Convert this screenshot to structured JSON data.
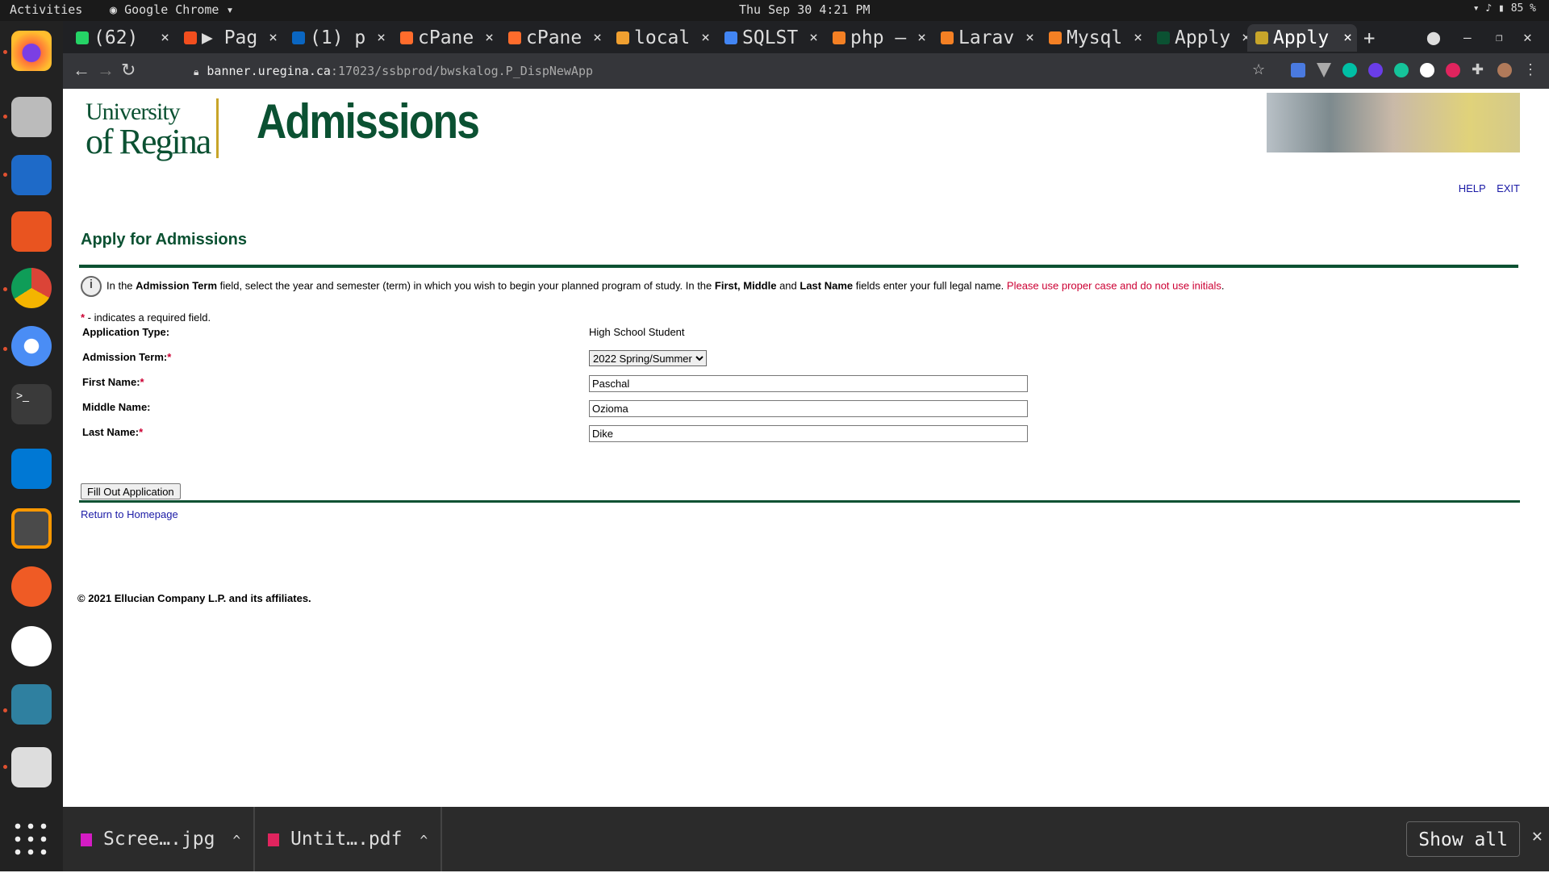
{
  "os": {
    "activities": "Activities",
    "app_name": "Google Chrome",
    "clock": "Thu Sep 30  4:21 PM",
    "battery": "85 %"
  },
  "dock": {
    "items": [
      "firefox-icon",
      "files-icon",
      "writer-icon",
      "software-center-icon",
      "chrome-icon",
      "chromium-icon",
      "terminal-icon",
      "vscode-icon",
      "sublime-icon",
      "postman-icon",
      "slack-icon",
      "vscodium-icon",
      "screenshot-viewer-icon",
      "app-grid-icon"
    ]
  },
  "tabs": [
    {
      "label": "(62)",
      "color": "#25d366"
    },
    {
      "label": "▶ Pag",
      "color": "#f24e1e"
    },
    {
      "label": "(1) p",
      "color": "#0a66c2"
    },
    {
      "label": "cPane",
      "color": "#ff6c2c"
    },
    {
      "label": "cPane",
      "color": "#ff6c2c"
    },
    {
      "label": "local",
      "color": "#f0a030"
    },
    {
      "label": "SQLST",
      "color": "#4285f4"
    },
    {
      "label": "php –",
      "color": "#f48024"
    },
    {
      "label": "Larav",
      "color": "#f48024"
    },
    {
      "label": "Mysql",
      "color": "#f48024"
    },
    {
      "label": "Apply",
      "color": "#0b5132"
    },
    {
      "label": "Apply",
      "color": "#c8a52a"
    }
  ],
  "url": {
    "host": "banner.uregina.ca",
    "path": ":17023/ssbprod/bwskalog.P_DispNewApp"
  },
  "header": {
    "logo_line1": "University",
    "logo_line2": "of Regina",
    "banner": "Admissions",
    "help": "HELP",
    "exit": "EXIT"
  },
  "page": {
    "title": "Apply for Admissions",
    "info_p1": "In the ",
    "info_b1": "Admission Term",
    "info_p2": " field, select the year and semester (term) in which you wish to begin your planned program of study. In the ",
    "info_b2": "First, Middle",
    "info_p3": " and ",
    "info_b3": "Last Name",
    "info_p4": " fields enter your full legal name. ",
    "info_red": "Please use proper case and do not use initials",
    "info_end": ".",
    "required_note": " - indicates a required field.",
    "required_mark": "*"
  },
  "form": {
    "app_type_label": "Application Type:",
    "app_type_value": "High School Student",
    "term_label": "Admission Term:",
    "term_value": "2022 Spring/Summer",
    "first_label": "First Name:",
    "first_value": "Paschal",
    "middle_label": "Middle Name:",
    "middle_value": "Ozioma",
    "last_label": "Last Name:",
    "last_value": "Dike",
    "submit": "Fill Out Application",
    "return_link": "Return to Homepage"
  },
  "footer": {
    "copyright": "© 2021 Ellucian Company L.P. and its affiliates."
  },
  "downloads": {
    "items": [
      "Scree….jpg",
      "Untit….pdf"
    ],
    "show_all": "Show all"
  }
}
